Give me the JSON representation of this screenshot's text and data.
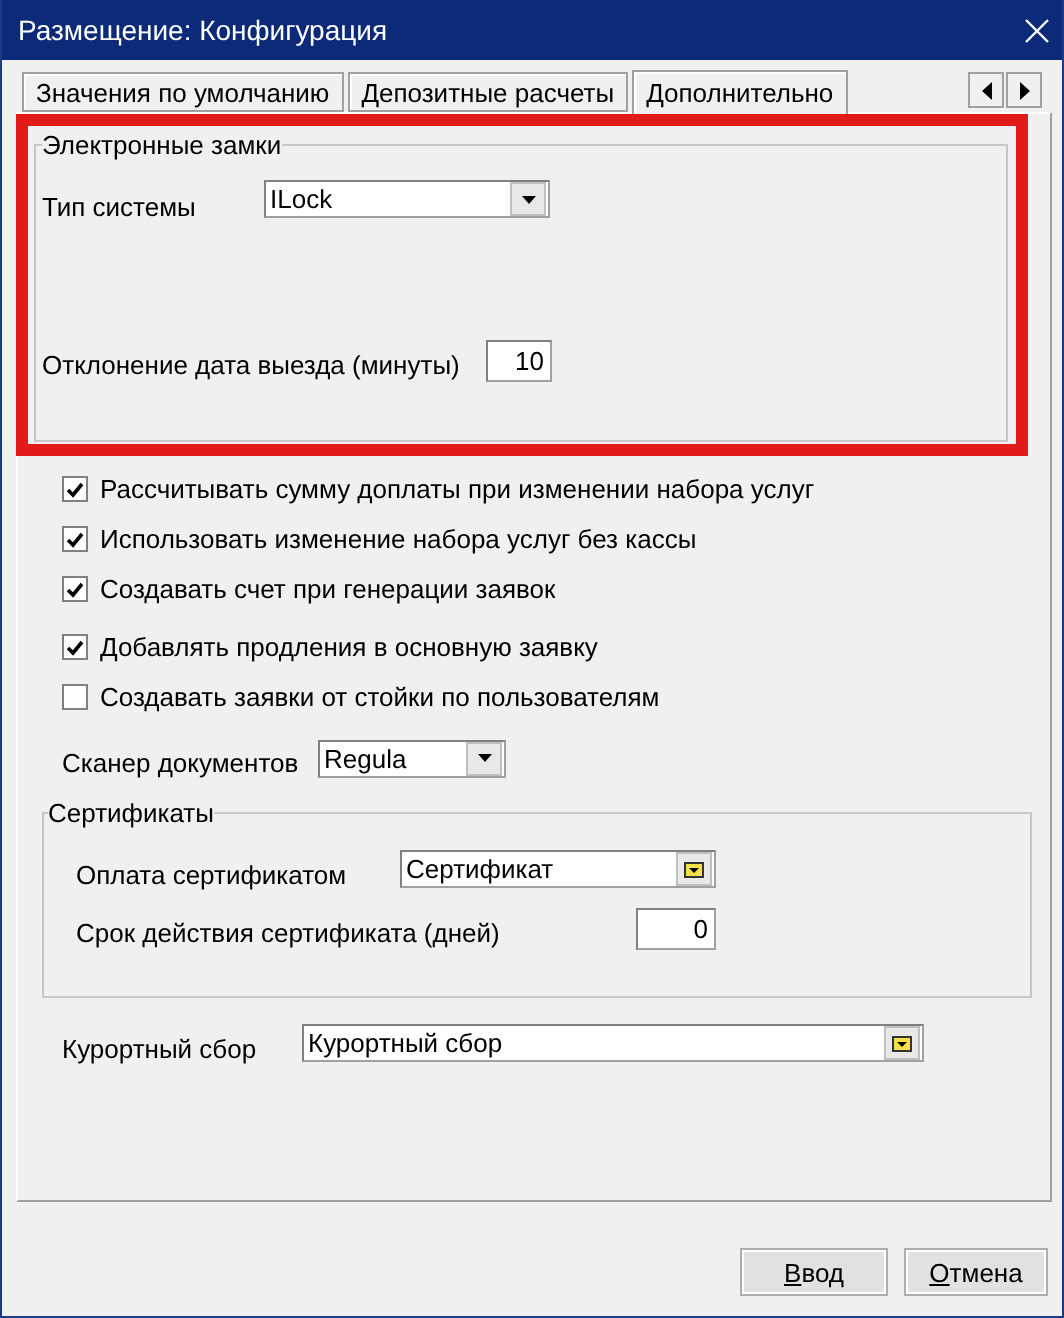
{
  "window": {
    "title": "Размещение: Конфигурация"
  },
  "tabs": [
    {
      "label": "Значения по умолчанию",
      "selected": false
    },
    {
      "label": "Депозитные расчеты",
      "selected": false
    },
    {
      "label": "Дополнительно",
      "selected": true
    }
  ],
  "electronic_locks": {
    "title": "Электронные замки",
    "system_type": {
      "label": "Тип системы",
      "value": "ILock"
    },
    "checkout_deviation": {
      "label": "Отклонение дата выезда (минуты)",
      "value": "10"
    }
  },
  "options": [
    {
      "label": "Рассчитывать сумму доплаты при изменении набора услуг",
      "checked": true
    },
    {
      "label": "Использовать изменение набора услуг без кассы",
      "checked": true
    },
    {
      "label": "Создавать счет при генерации заявок",
      "checked": true
    },
    {
      "label": "Добавлять продления в основную заявку",
      "checked": true
    },
    {
      "label": "Создавать заявки от стойки по пользователям",
      "checked": false
    }
  ],
  "document_scanner": {
    "label": "Сканер документов",
    "value": "Regula"
  },
  "certificates": {
    "title": "Сертификаты",
    "payment": {
      "label": "Оплата сертификатом",
      "value": "Сертификат"
    },
    "validity": {
      "label": "Срок действия сертификата (дней)",
      "value": "0"
    }
  },
  "resort_fee": {
    "label": "Курортный сбор",
    "value": "Курортный сбор"
  },
  "buttons": [
    {
      "label": "Ввод"
    },
    {
      "label": "Отмена"
    }
  ]
}
